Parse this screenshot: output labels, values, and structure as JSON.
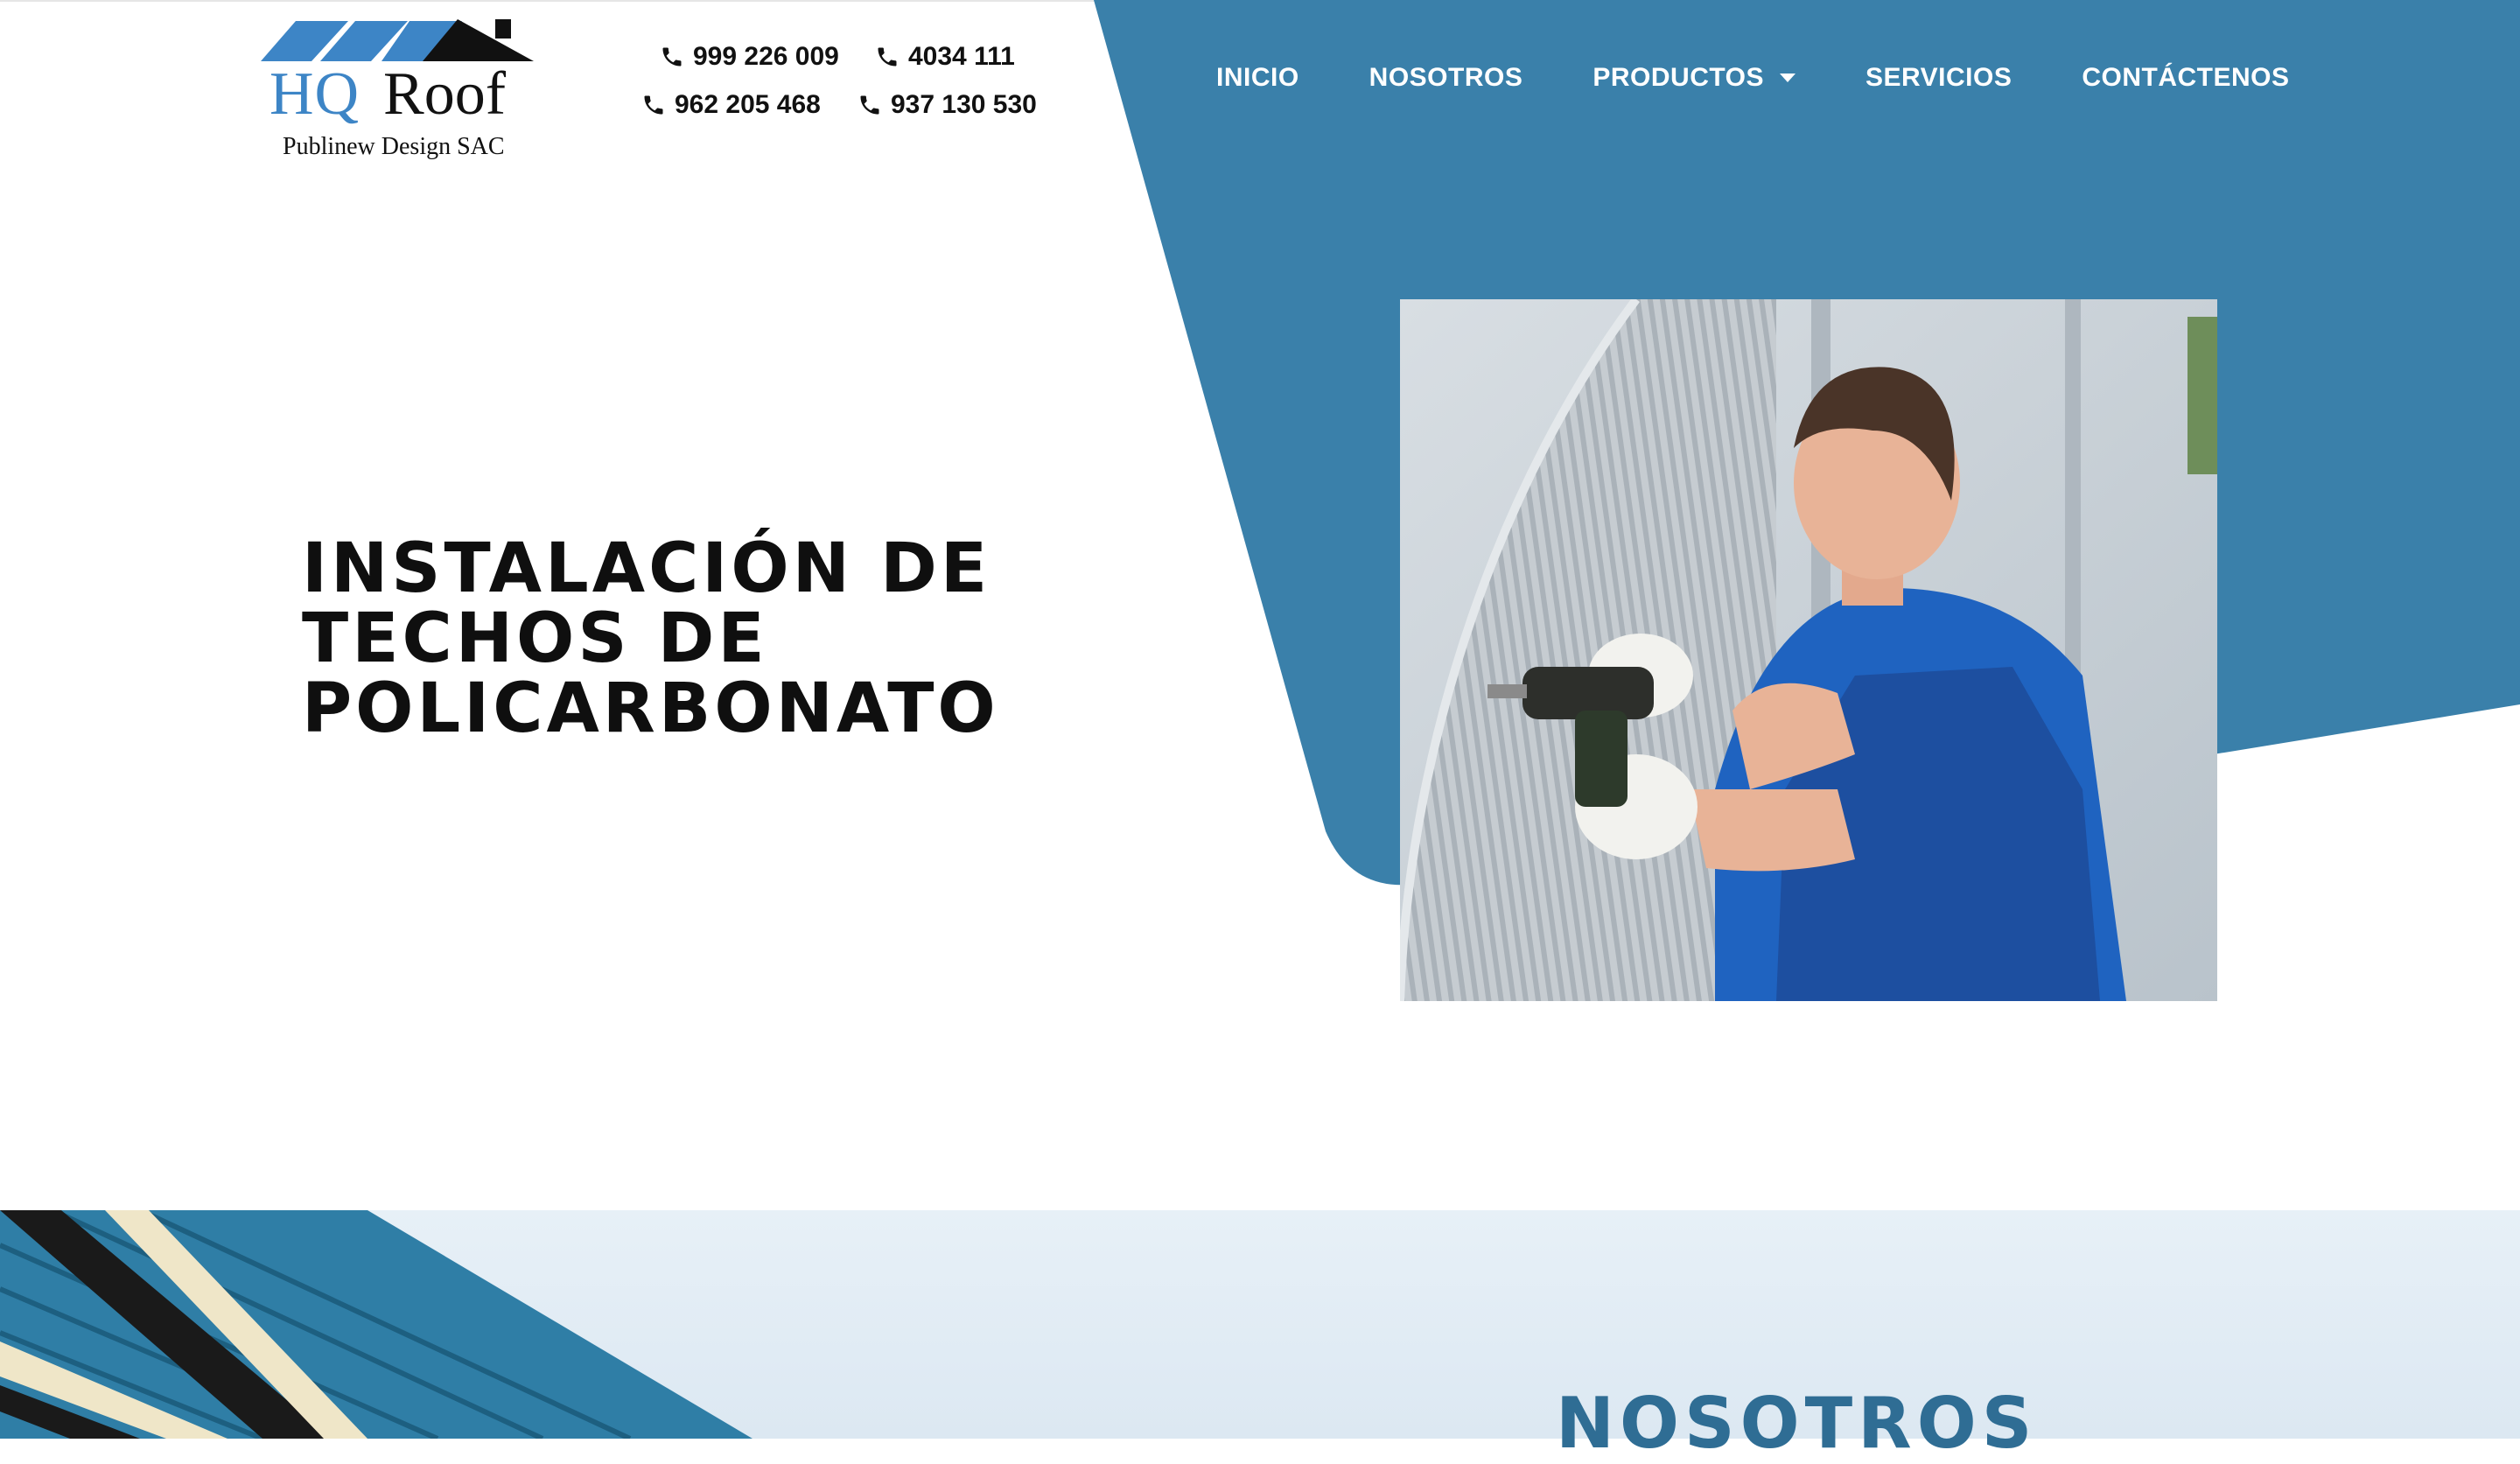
{
  "brand": {
    "name_part1": "HQ",
    "name_part2": "Roof",
    "tagline": "Publinew Design SAC",
    "colors": {
      "accent_blue": "#3a80aa",
      "logo_blue": "#3d85c6",
      "text_dark": "#111111"
    }
  },
  "contact": {
    "phones": [
      "999 226 009",
      "4034 111",
      "962 205 468",
      "937 130 530"
    ],
    "icon": "phone-icon"
  },
  "nav": {
    "items": [
      {
        "label": "INICIO"
      },
      {
        "label": "NOSOTROS"
      },
      {
        "label": "PRODUCTOS",
        "has_dropdown": true
      },
      {
        "label": "SERVICIOS"
      },
      {
        "label": "CONTÁCTENOS"
      }
    ]
  },
  "hero": {
    "title_lines": [
      "INSTALACIÓN DE",
      "TECHOS DE",
      "POLICARBONATO"
    ],
    "image": "worker-drilling-polycarbonate-roof-photo"
  },
  "section2": {
    "title": "NOSOTROS",
    "image": "metal-roof-beams-photo"
  }
}
